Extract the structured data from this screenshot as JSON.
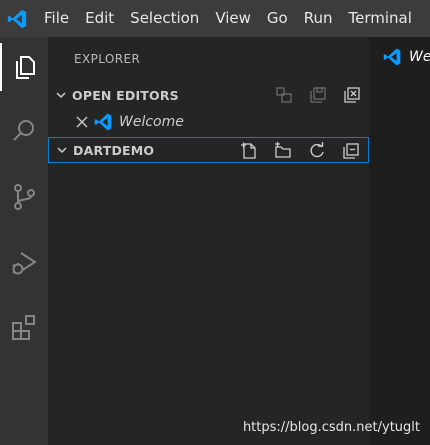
{
  "titlebar": {
    "logo_icon": "vscode-logo-icon",
    "menu": [
      "File",
      "Edit",
      "Selection",
      "View",
      "Go",
      "Run",
      "Terminal"
    ]
  },
  "activity_bar": {
    "items": [
      "explorer-icon",
      "search-icon",
      "source-control-icon",
      "run-debug-icon",
      "extensions-icon"
    ],
    "active": "explorer-icon"
  },
  "sidebar": {
    "title": "EXPLORER",
    "open_editors": {
      "label": "OPEN EDITORS",
      "actions": [
        "new-untitled-file-icon",
        "save-all-icon",
        "close-all-icon"
      ],
      "items": [
        {
          "name": "Welcome",
          "icon": "vscode-logo-icon"
        }
      ]
    },
    "folder": {
      "label": "DARTDEMO",
      "actions": [
        "new-file-icon",
        "new-folder-icon",
        "refresh-icon",
        "collapse-all-icon"
      ]
    }
  },
  "editor": {
    "tab_label": "Welcome"
  },
  "watermark": "https://blog.csdn.net/ytuglt",
  "colors": {
    "titlebar": "#3c3c3c",
    "activity_bar": "#333333",
    "sidebar": "#252526",
    "editor": "#1e1e1e",
    "accent": "#007fd4",
    "logo_blue": "#0a9bff"
  }
}
